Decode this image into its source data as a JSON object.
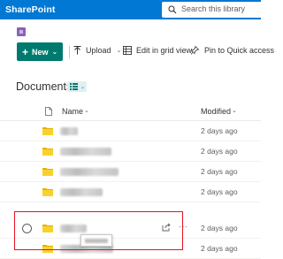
{
  "suite_bar": {
    "app_name": "SharePoint",
    "search_placeholder": "Search this library"
  },
  "command_bar": {
    "new_label": "New",
    "upload_label": "Upload",
    "grid_view_label": "Edit in grid view",
    "pin_label": "Pin to Quick access"
  },
  "library": {
    "title": "Documents"
  },
  "list": {
    "columns": {
      "name": "Name",
      "modified": "Modified"
    },
    "rows": [
      {
        "modified": "2 days ago"
      },
      {
        "modified": "2 days ago"
      },
      {
        "modified": "2 days ago"
      },
      {
        "modified": "2 days ago"
      },
      {
        "modified": "2 days ago"
      },
      {
        "modified": "2 days ago"
      }
    ]
  },
  "colors": {
    "suite_bar": "#0078d4",
    "new_button": "#007a6e",
    "folder": "#f8d22a",
    "highlight_box": "#e81123"
  }
}
